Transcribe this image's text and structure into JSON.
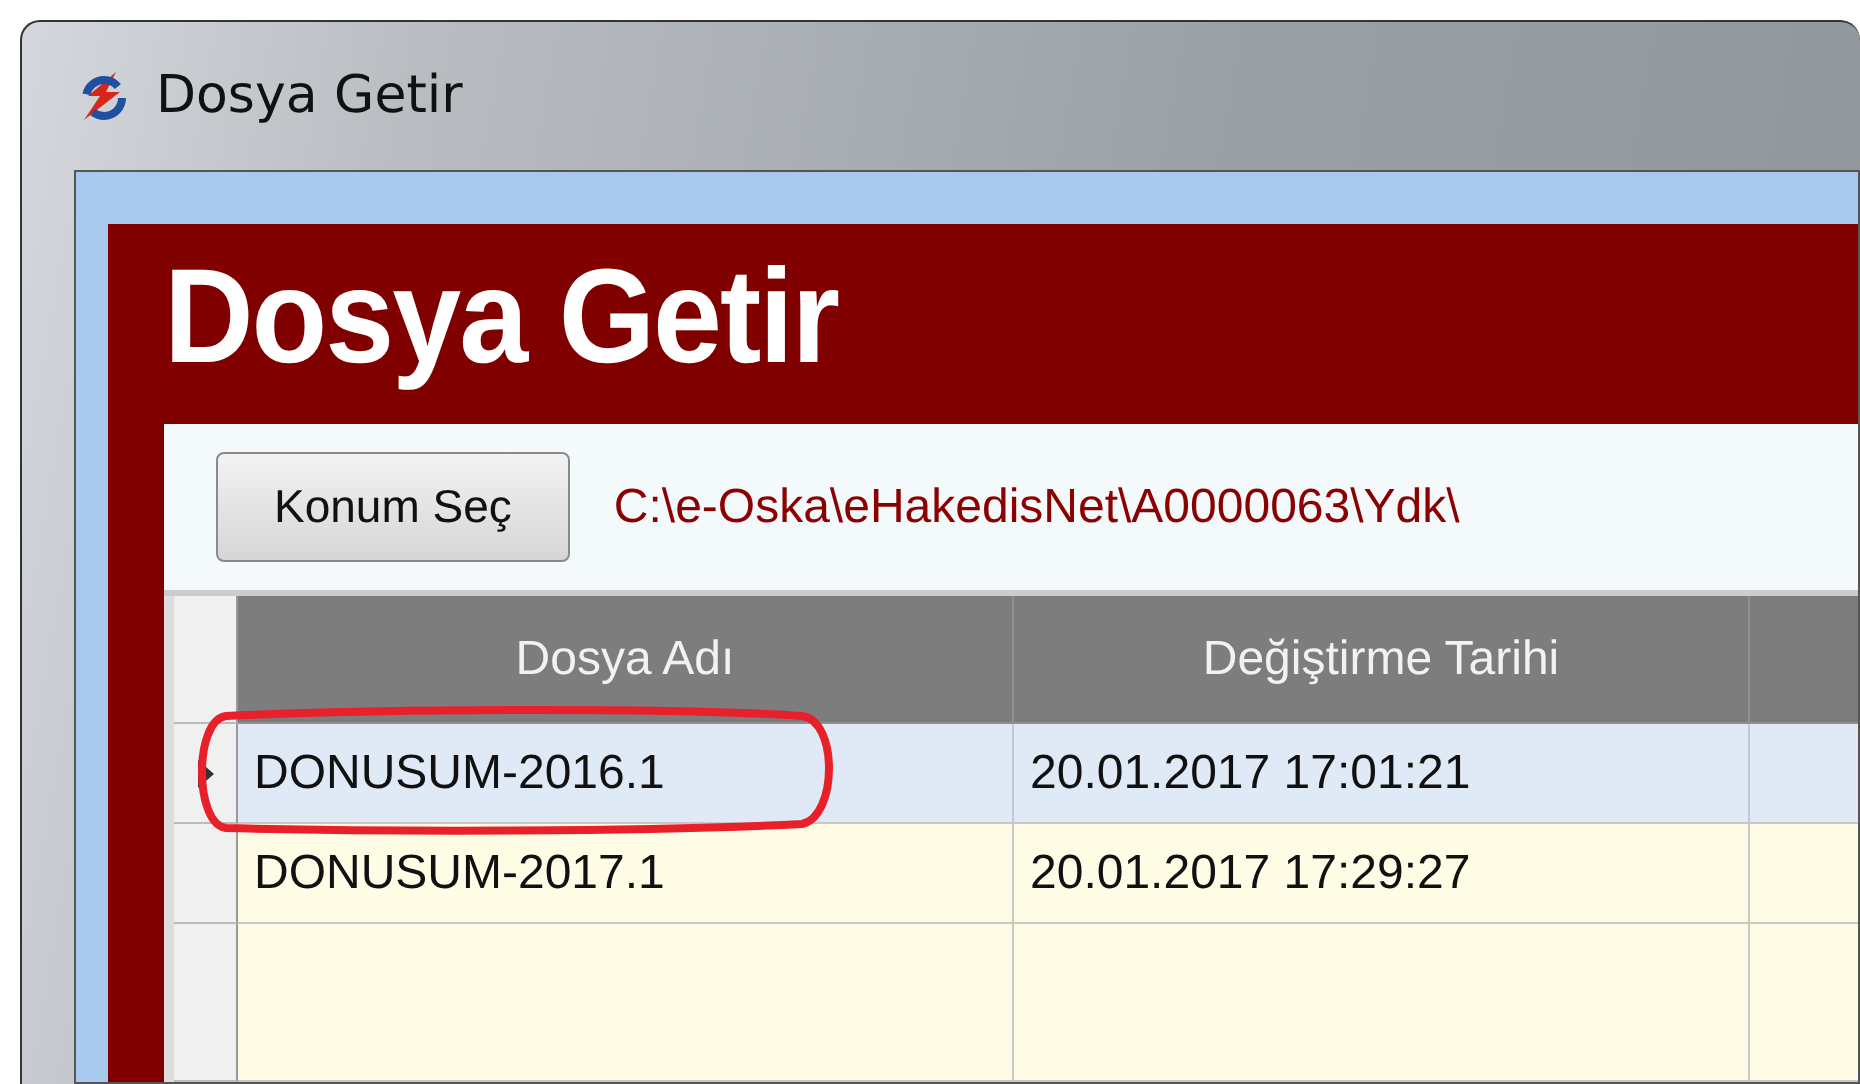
{
  "window": {
    "title": "Dosya Getir"
  },
  "header": {
    "title": "Dosya Getir"
  },
  "toolbar": {
    "button": "Konum Seç",
    "path": "C:\\e-Oska\\eHakedisNet\\A0000063\\Ydk\\"
  },
  "table": {
    "columns": [
      "Dosya Adı",
      "Değiştirme Tarihi"
    ],
    "rows": [
      {
        "cells": [
          "DONUSUM-2016.1",
          "20.01.2017 17:01:21"
        ],
        "selected": true,
        "circled": true
      },
      {
        "cells": [
          "DONUSUM-2017.1",
          "20.01.2017 17:29:27"
        ],
        "selected": false,
        "circled": false
      }
    ]
  }
}
